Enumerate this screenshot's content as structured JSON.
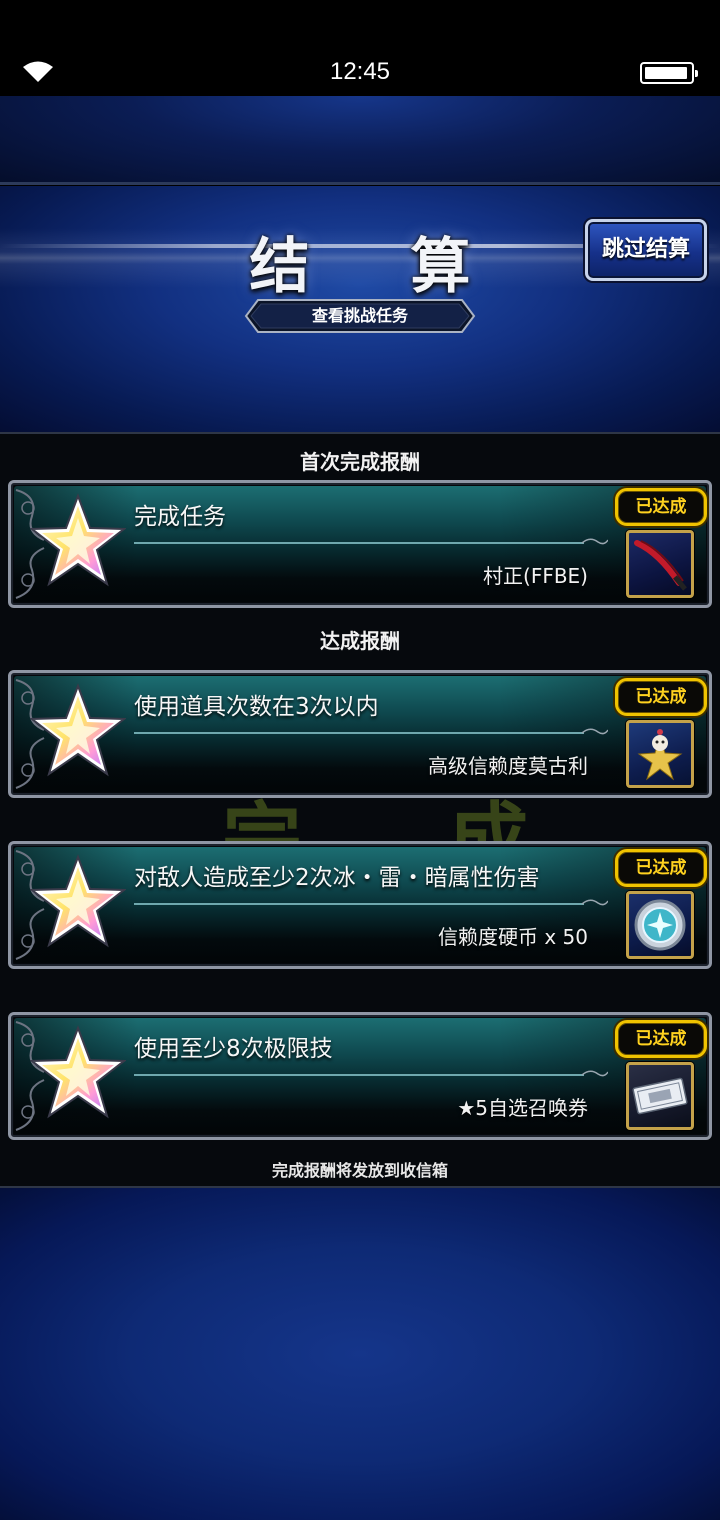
{
  "status_bar": {
    "time": "12:45"
  },
  "header": {
    "title": "结 算",
    "skip_label": "跳过结算",
    "mission_button_label": "查看挑战任务"
  },
  "watermark": {
    "chars": [
      "完",
      "成"
    ]
  },
  "sections": {
    "first_clear": "首次完成报酬",
    "achievement": "达成报酬"
  },
  "rewards": [
    {
      "title": "完成任务",
      "reward": "村正(FFBE)",
      "badge": "已达成",
      "icon": "katana-icon"
    },
    {
      "title": "使用道具次数在3次以内",
      "reward": "高级信赖度莫古利",
      "badge": "已达成",
      "icon": "moogle-star-icon"
    },
    {
      "title": "对敌人造成至少2次冰・雷・暗属性伤害",
      "reward": "信赖度硬币 x 50",
      "badge": "已达成",
      "icon": "trust-coin-icon"
    },
    {
      "title": "使用至少8次极限技",
      "reward": "★5自选召唤券",
      "badge": "已达成",
      "icon": "summon-ticket-icon"
    }
  ],
  "footer_note": "完成报酬将发放到收信箱",
  "colors": {
    "badge": "#f0c300",
    "header_blue": "#123081",
    "card_teal": "#0f4a50"
  }
}
